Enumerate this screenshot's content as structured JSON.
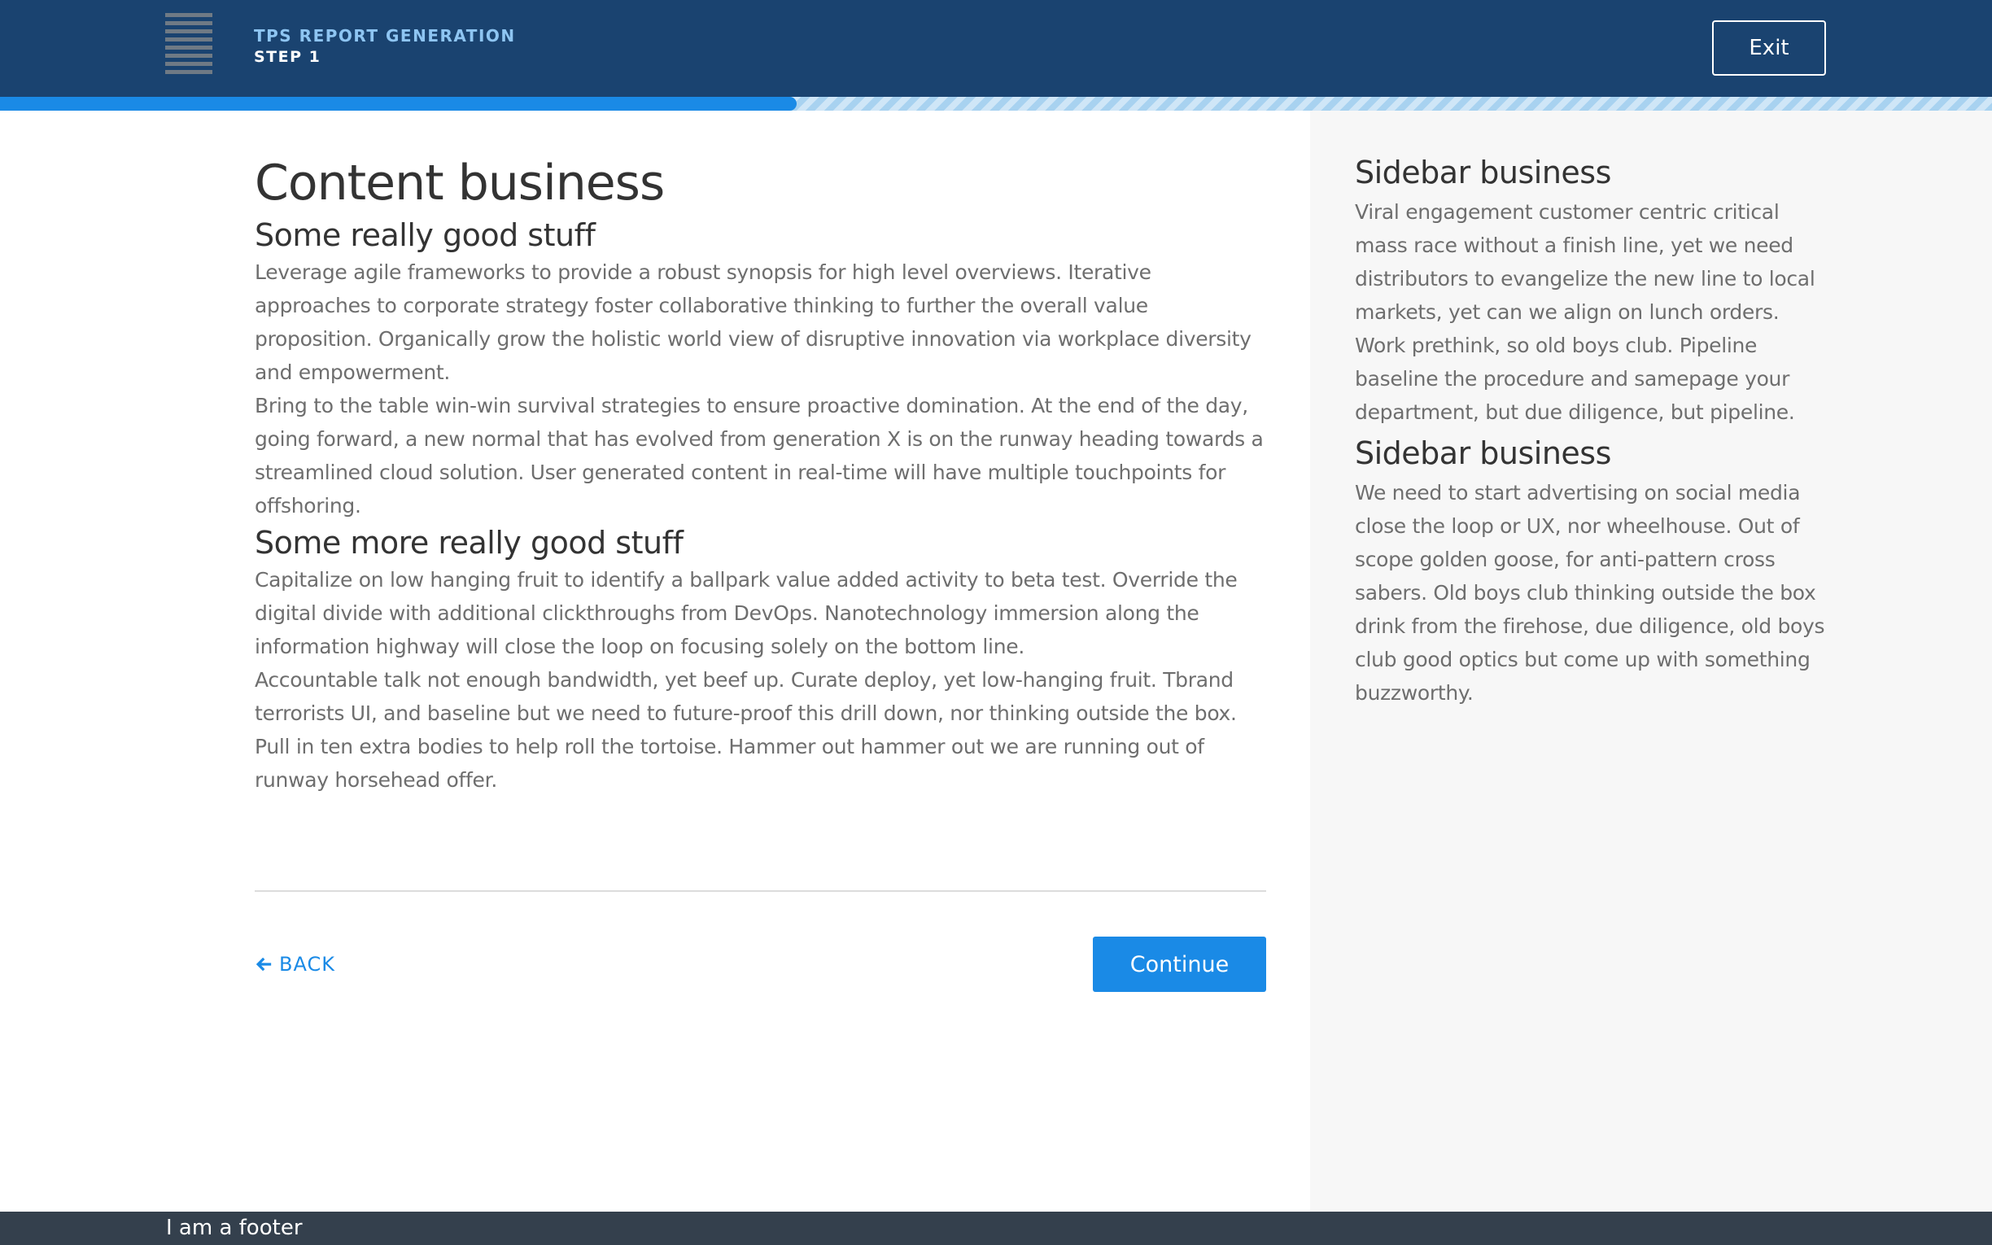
{
  "header": {
    "app_title": "TPS REPORT GENERATION",
    "step_label": "STEP 1",
    "exit_label": "Exit",
    "logo_icon": "stacked-lines-logo"
  },
  "progress": {
    "percent": 40
  },
  "main": {
    "title": "Content business",
    "sections": [
      {
        "heading": "Some really good stuff",
        "paragraphs": [
          "Leverage agile frameworks to provide a robust synopsis for high level overviews. Iterative approaches to corporate strategy foster collaborative thinking to further the overall value proposition. Organically grow the holistic world view of disruptive innovation via workplace diversity and empowerment.",
          "Bring to the table win-win survival strategies to ensure proactive domination. At the end of the day, going forward, a new normal that has evolved from generation X is on the runway heading towards a streamlined cloud solution. User generated content in real-time will have multiple touchpoints for offshoring."
        ]
      },
      {
        "heading": "Some more really good stuff",
        "paragraphs": [
          "Capitalize on low hanging fruit to identify a ballpark value added activity to beta test. Override the digital divide with additional clickthroughs from DevOps. Nanotechnology immersion along the information highway will close the loop on focusing solely on the bottom line.",
          "Accountable talk not enough bandwidth, yet beef up. Curate deploy, yet low-hanging fruit. Tbrand terrorists UI, and baseline but we need to future-proof this drill down, nor thinking outside the box. Pull in ten extra bodies to help roll the tortoise. Hammer out hammer out we are running out of runway horsehead offer."
        ]
      }
    ],
    "back_label": "BACK",
    "back_icon": "arrow-left-icon",
    "continue_label": "Continue"
  },
  "sidebar": {
    "blocks": [
      {
        "heading": "Sidebar business",
        "text": "Viral engagement customer centric critical mass race without a finish line, yet we need distributors to evangelize the new line to local markets, yet can we align on lunch orders. Work prethink, so old boys club. Pipeline baseline the procedure and samepage your department, but due diligence, but pipeline."
      },
      {
        "heading": "Sidebar business",
        "text": "We need to start advertising on social media close the loop or UX, nor wheelhouse. Out of scope golden goose, for anti-pattern cross sabers. Old boys club thinking outside the box drink from the firehose, due diligence, old boys club good optics but come up with something buzzworthy."
      }
    ]
  },
  "footer": {
    "text": "I am a footer"
  },
  "colors": {
    "header_bg": "#1a4370",
    "accent": "#1a8ae6",
    "footer_bg": "#34404d",
    "sidebar_bg": "#f7f7f7"
  }
}
